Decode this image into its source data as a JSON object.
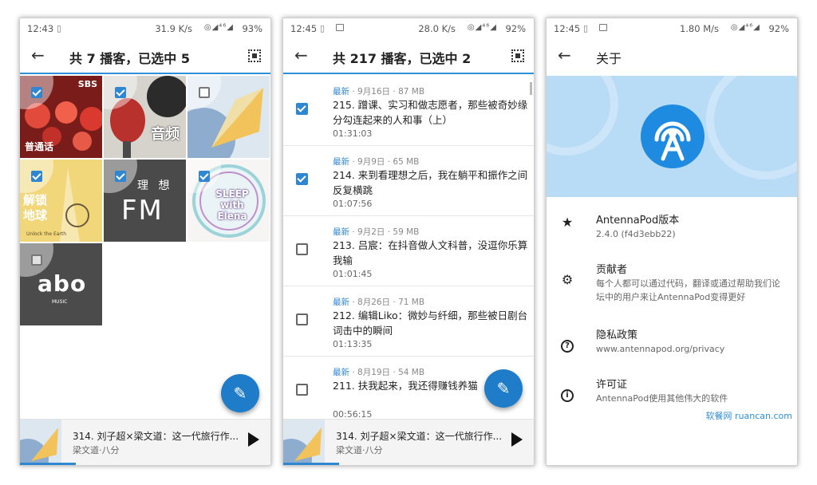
{
  "panel1": {
    "status": {
      "time": "12:43",
      "speed": "31.9 K/s",
      "icons": "◎◢⁴⁶◢",
      "battery": "93%"
    },
    "title": "共 7 播客，已选中 5",
    "tiles": [
      {
        "caption": "普通话",
        "brand": "SBS",
        "checked": true
      },
      {
        "caption": "音频",
        "checked": true
      },
      {
        "caption": "",
        "checked": false
      },
      {
        "caption": "解锁\n地球",
        "sub": "Unlock the Earth",
        "checked": true
      },
      {
        "caption": "FM",
        "sub": "理 想",
        "checked": true
      },
      {
        "caption": "SLEEP with Elena",
        "checked": true
      },
      {
        "caption": "abo",
        "sub": "MUSIC",
        "checked": false
      }
    ],
    "player": {
      "title": "314. 刘子超×梁文道：这一代旅行作...",
      "subtitle": "梁文道·八分"
    }
  },
  "panel2": {
    "status": {
      "time": "12:45",
      "speed": "28.0 K/s",
      "icons": "◎◢⁴⁶◢",
      "battery": "92%"
    },
    "title": "共 217 播客，已选中 2",
    "episodes": [
      {
        "new": "最新",
        "meta": " · 9月16日 · 87 MB",
        "title": "215. 蹭课、实习和做志愿者，那些被奇妙缘分勾连起来的人和事（上）",
        "duration": "01:31:03",
        "checked": true
      },
      {
        "new": "最新",
        "meta": " · 9月9日 · 65 MB",
        "title": "214. 来到看理想之后，我在躺平和振作之间反复横跳",
        "duration": "01:07:56",
        "checked": true
      },
      {
        "new": "最新",
        "meta": " · 9月2日 · 59 MB",
        "title": "213. 吕宸：在抖音做人文科普，没逗你乐算我输",
        "duration": "01:01:45",
        "checked": false
      },
      {
        "new": "最新",
        "meta": " · 8月26日 · 71 MB",
        "title": "212. 编辑Liko：微妙与纤细，那些被日剧台词击中的瞬间",
        "duration": "01:13:35",
        "checked": false
      },
      {
        "new": "最新",
        "meta": " · 8月19日 · 54 MB",
        "title": "211. 扶我起来，我还得赚钱养猫",
        "duration": "00:56:15",
        "checked": false
      }
    ],
    "player": {
      "title": "314. 刘子超×梁文道：这一代旅行作...",
      "subtitle": "梁文道·八分"
    }
  },
  "panel3": {
    "status": {
      "time": "12:45",
      "speed": "1.80 M/s",
      "icons": "◎◢⁴⁶◢",
      "battery": "92%"
    },
    "title": "关于",
    "items": [
      {
        "icon": "star-icon",
        "title": "AntennaPod版本",
        "subtitle": "2.4.0 (f4d3ebb22)"
      },
      {
        "icon": "gear-icon",
        "title": "贡献者",
        "subtitle": "每个人都可以通过代码，翻译或通过帮助我们论坛中的用户来让AntennaPod变得更好"
      },
      {
        "icon": "help-icon",
        "title": "隐私政策",
        "subtitle": "www.antennapod.org/privacy"
      },
      {
        "icon": "info-icon",
        "title": "许可证",
        "subtitle": "AntennaPod使用其他伟大的软件"
      }
    ],
    "watermark": "软餐网 ruancan.com"
  },
  "colors": {
    "accent": "#2f86d1",
    "fab": "#1f7cc8",
    "hero": "#b9dcf6",
    "logo": "#1f8be0"
  }
}
